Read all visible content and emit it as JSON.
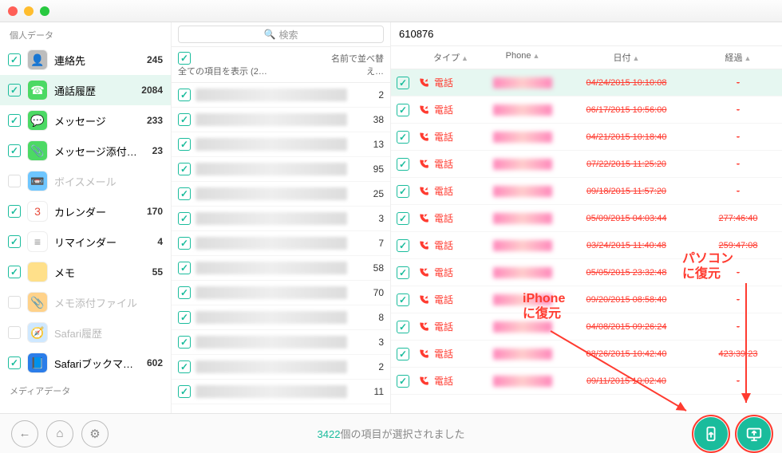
{
  "titlebar": {},
  "sidebar": {
    "section1": "個人データ",
    "section2": "メディアデータ",
    "items": [
      {
        "label": "連絡先",
        "count": 245,
        "checked": true,
        "enabled": true,
        "bg": "#bdbdbd",
        "glyph": "👤"
      },
      {
        "label": "通話履歴",
        "count": 2084,
        "checked": true,
        "enabled": true,
        "bg": "#4cd964",
        "glyph": "☎",
        "selected": true
      },
      {
        "label": "メッセージ",
        "count": 233,
        "checked": true,
        "enabled": true,
        "bg": "#4cd964",
        "glyph": "💬"
      },
      {
        "label": "メッセージ添付…",
        "count": 23,
        "checked": true,
        "enabled": true,
        "bg": "#4cd964",
        "glyph": "📎"
      },
      {
        "label": "ボイスメール",
        "count": "",
        "checked": false,
        "enabled": false,
        "bg": "#6ec6ff",
        "glyph": "📼"
      },
      {
        "label": "カレンダー",
        "count": 170,
        "checked": true,
        "enabled": true,
        "bg": "#fff",
        "glyph": "3",
        "fg": "#e74c3c"
      },
      {
        "label": "リマインダー",
        "count": 4,
        "checked": true,
        "enabled": true,
        "bg": "#fff",
        "glyph": "≡",
        "fg": "#888"
      },
      {
        "label": "メモ",
        "count": 55,
        "checked": true,
        "enabled": true,
        "bg": "#ffe08a",
        "glyph": ""
      },
      {
        "label": "メモ添付ファイル",
        "count": "",
        "checked": false,
        "enabled": false,
        "bg": "#ffd28a",
        "glyph": "📎"
      },
      {
        "label": "Safari履歴",
        "count": "",
        "checked": false,
        "enabled": false,
        "bg": "#cfe8ff",
        "glyph": "🧭"
      },
      {
        "label": "Safariブックマ…",
        "count": 602,
        "checked": true,
        "enabled": true,
        "bg": "#2b7de9",
        "glyph": "📘"
      }
    ]
  },
  "search": {
    "placeholder": "検索"
  },
  "mid": {
    "col1": "全ての項目を表示 (2…",
    "col2": "名前で並べ替え…",
    "rows": [
      {
        "n": 2
      },
      {
        "n": 38
      },
      {
        "n": 13
      },
      {
        "n": 95
      },
      {
        "n": 25
      },
      {
        "n": 3
      },
      {
        "n": 7
      },
      {
        "n": 58
      },
      {
        "n": 70
      },
      {
        "n": 8
      },
      {
        "n": 3
      },
      {
        "n": 2
      },
      {
        "n": 11
      }
    ]
  },
  "right": {
    "title": "610876",
    "head": {
      "type": "タイプ",
      "phone": "Phone",
      "date": "日付",
      "dur": "経過"
    },
    "rows": [
      {
        "type": "電話",
        "in": true,
        "date": "04/24/2015 10:10:08",
        "dur": "-",
        "sel": true
      },
      {
        "type": "電話",
        "in": true,
        "date": "06/17/2015 10:56:00",
        "dur": "-"
      },
      {
        "type": "電話",
        "in": true,
        "date": "04/21/2015 10:18:40",
        "dur": "-"
      },
      {
        "type": "電話",
        "in": false,
        "date": "07/22/2015 11:25:20",
        "dur": "-"
      },
      {
        "type": "電話",
        "in": true,
        "date": "09/18/2015 11:57:20",
        "dur": "-"
      },
      {
        "type": "電話",
        "in": false,
        "date": "05/09/2015 04:03:44",
        "dur": "277:46:40"
      },
      {
        "type": "電話",
        "in": true,
        "date": "03/24/2015 11:40:48",
        "dur": "259:47:08"
      },
      {
        "type": "電話",
        "in": false,
        "date": "05/05/2015 23:32:48",
        "dur": "-"
      },
      {
        "type": "電話",
        "in": true,
        "date": "09/20/2015 08:58:40",
        "dur": "-"
      },
      {
        "type": "電話",
        "in": false,
        "date": "04/08/2015 09:26:24",
        "dur": "-"
      },
      {
        "type": "電話",
        "in": true,
        "date": "08/26/2015 10:42:40",
        "dur": "423:39:23"
      },
      {
        "type": "電話",
        "in": false,
        "date": "09/11/2015 10:02:40",
        "dur": "-"
      }
    ]
  },
  "footer": {
    "count": "3422",
    "suffix": "個の項目が選択されました"
  },
  "anno": {
    "iphone": "iPhone\nに復元",
    "pc": "パソコン\nに復元"
  }
}
